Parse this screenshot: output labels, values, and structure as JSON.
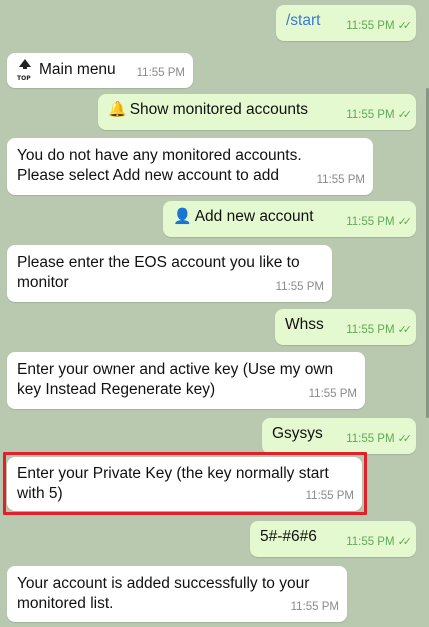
{
  "messages": [
    {
      "id": "m1",
      "dir": "out",
      "text": "/start",
      "time": "11:55 PM",
      "link": true
    },
    {
      "id": "m2",
      "dir": "in",
      "icon": "top-icon",
      "icon_label": "TOP",
      "text": "Main menu",
      "time": "11:55 PM"
    },
    {
      "id": "m3",
      "dir": "out",
      "emoji": "🔔",
      "text": "Show monitored accounts",
      "time": "11:55 PM"
    },
    {
      "id": "m4",
      "dir": "in",
      "lines": [
        "You do not have any monitored accounts.",
        "Please select Add new account to add"
      ],
      "time": "11:55 PM"
    },
    {
      "id": "m5",
      "dir": "out",
      "emoji": "👤",
      "text": "Add new account",
      "time": "11:55 PM"
    },
    {
      "id": "m6",
      "dir": "in",
      "lines": [
        "Please enter the EOS account you like to",
        "monitor"
      ],
      "time": "11:55 PM"
    },
    {
      "id": "m7",
      "dir": "out",
      "text": "Whss",
      "time": "11:55 PM"
    },
    {
      "id": "m8",
      "dir": "in",
      "lines": [
        "Enter your owner and active key (Use my own",
        "key Instead Regenerate key)"
      ],
      "time": "11:55 PM"
    },
    {
      "id": "m9",
      "dir": "out",
      "text": "Gsysys",
      "time": "11:55 PM"
    },
    {
      "id": "m10",
      "dir": "in",
      "lines": [
        "Enter your Private Key (the key normally start",
        "with 5)"
      ],
      "time": "11:55 PM"
    },
    {
      "id": "m11",
      "dir": "out",
      "text": "5#-#6#6",
      "time": "11:55 PM"
    },
    {
      "id": "m12",
      "dir": "in",
      "lines": [
        "Your account is added successfully to your",
        "monitored list."
      ],
      "time": "11:55 PM"
    }
  ],
  "colors": {
    "incoming": "#ffffff",
    "outgoing": "#e4f9cf",
    "highlight": "#e0202b",
    "background": "#b9c9b0"
  }
}
